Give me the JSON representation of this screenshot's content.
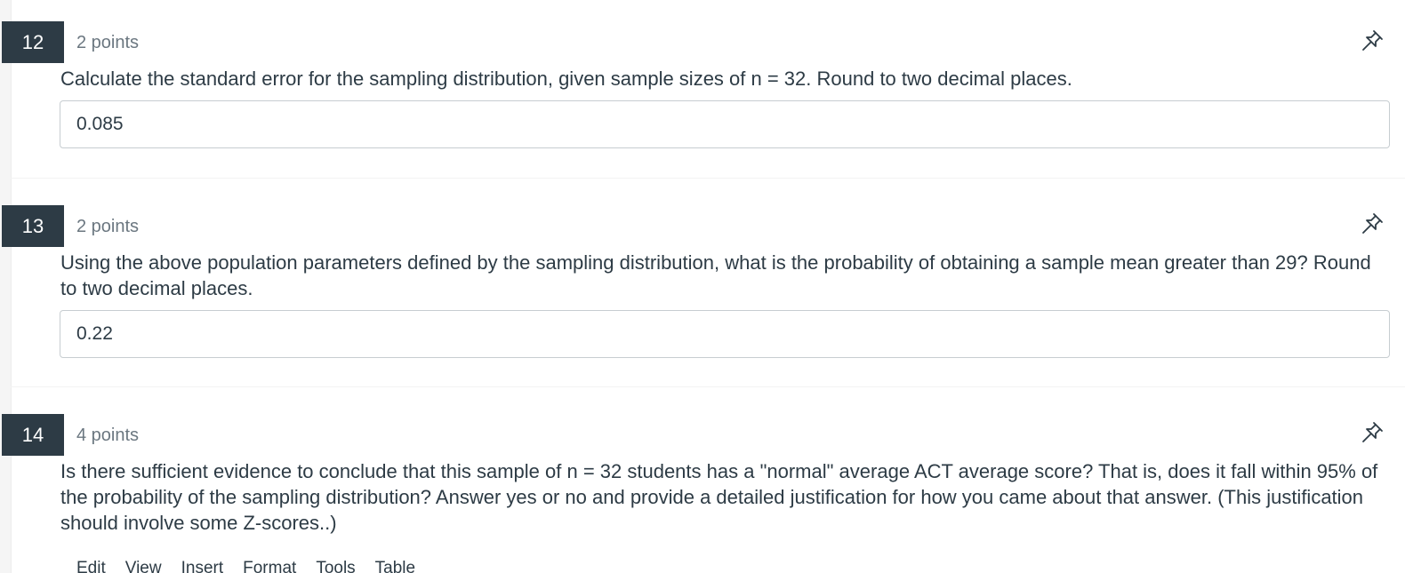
{
  "questions": [
    {
      "number": "12",
      "points": "2 points",
      "text": "Calculate the standard error for the sampling distribution, given sample sizes of n = 32. Round to two decimal places.",
      "answer": "0.085",
      "pin_icon": "pin-icon"
    },
    {
      "number": "13",
      "points": "2 points",
      "text": "Using the above population parameters defined by the sampling distribution, what is the probability of obtaining a sample mean greater than 29? Round to two decimal places.",
      "answer": "0.22",
      "pin_icon": "pin-icon"
    },
    {
      "number": "14",
      "points": "4 points",
      "text": "Is there sufficient evidence to conclude that this sample of n = 32 students has a \"normal\" average ACT average score? That is, does it fall within 95% of the probability of the sampling distribution? Answer yes or no and provide a detailed justification for how you came about that answer. (This justification should involve some Z-scores..)",
      "pin_icon": "pin-icon"
    }
  ],
  "editor_menu": [
    "Edit",
    "View",
    "Insert",
    "Format",
    "Tools",
    "Table"
  ],
  "colors": {
    "number_badge_bg": "#2d3b45",
    "number_badge_text": "#ffffff",
    "text": "#2d3b45",
    "points_text": "#6b7780",
    "input_border": "#c7cdd1"
  }
}
